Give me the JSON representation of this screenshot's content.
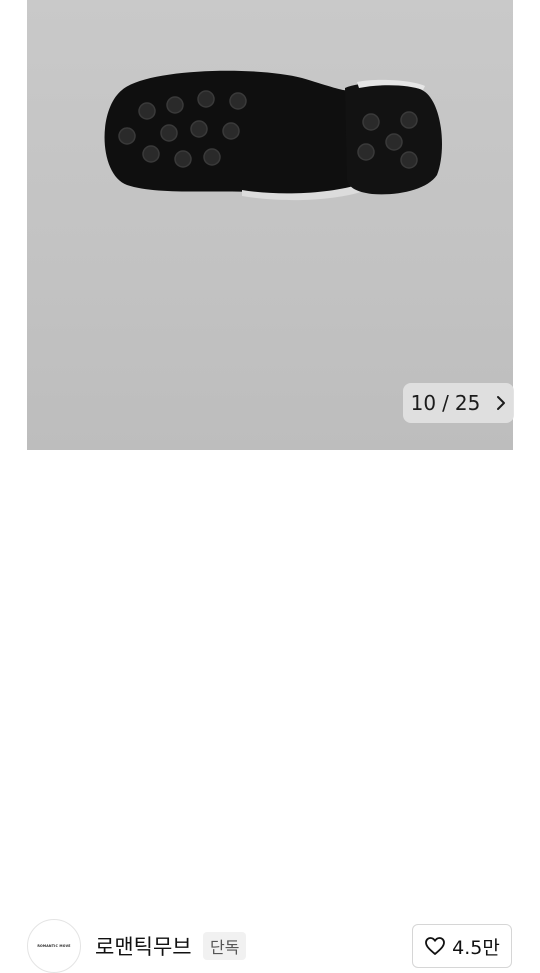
{
  "gallery": {
    "current_index": "10",
    "total": "25",
    "separator": "/",
    "next_icon": "chevron-right-icon",
    "image_subject": "shoe-sole"
  },
  "brand": {
    "logo_text": "ROMANTIC MOVE",
    "name": "로맨틱무브",
    "badge": "단독"
  },
  "like": {
    "icon": "heart-outline-icon",
    "count": "4.5만"
  },
  "colors": {
    "image_background": "#c5c5c5",
    "sole": "#111111",
    "text": "#111111",
    "badge_bg": "#f1f1f1"
  }
}
